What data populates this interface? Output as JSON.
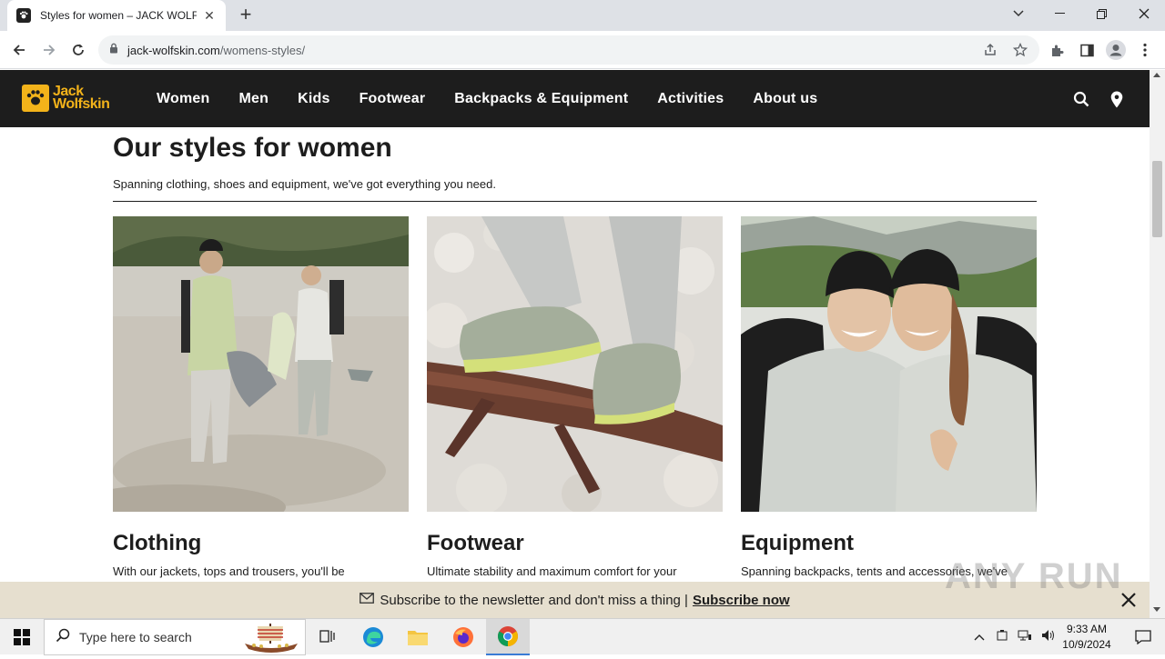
{
  "browser": {
    "tab_title": "Styles for women – JACK WOLFSKIN",
    "url_host": "jack-wolfskin.com",
    "url_path": "/womens-styles/"
  },
  "site": {
    "logo_line1": "Jack",
    "logo_line2": "Wolfskin",
    "nav": [
      "Women",
      "Men",
      "Kids",
      "Footwear",
      "Backpacks & Equipment",
      "Activities",
      "About us"
    ],
    "brand_color": "#f3b31a",
    "header_bg": "#1d1d1d"
  },
  "page": {
    "title": "Our styles for women",
    "subtitle": "Spanning clothing, shoes and equipment, we've got everything you need.",
    "cards": [
      {
        "title": "Clothing",
        "desc": "With our jackets, tops and trousers, you'll be"
      },
      {
        "title": "Footwear",
        "desc": "Ultimate stability and maximum comfort for your"
      },
      {
        "title": "Equipment",
        "desc": "Spanning backpacks, tents and accessories, we've"
      }
    ]
  },
  "newsletter": {
    "text": "Subscribe to the newsletter and don't miss a thing |",
    "link": "Subscribe now"
  },
  "watermark": "ANY RUN",
  "taskbar": {
    "search_placeholder": "Type here to search",
    "time": "9:33 AM",
    "date": "10/9/2024"
  }
}
